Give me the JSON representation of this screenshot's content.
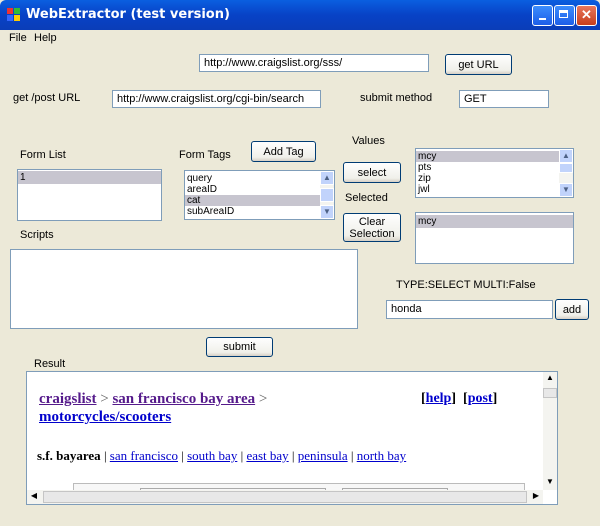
{
  "window": {
    "title": "WebExtractor (test version)"
  },
  "menu": {
    "file": "File",
    "help": "Help"
  },
  "url_input": {
    "value": "http://www.craigslist.org/sss/"
  },
  "get_url_button": "get URL",
  "get_post_label": "get /post URL",
  "post_url_input": {
    "value": "http://www.craigslist.org/cgi-bin/search"
  },
  "submit_method_label": "submit method",
  "submit_method_input": {
    "value": "GET"
  },
  "values_label": "Values",
  "form_list_label": "Form List",
  "form_list": {
    "items": [
      "1"
    ]
  },
  "form_tags_label": "Form Tags",
  "add_tag_button": "Add Tag",
  "form_tags": {
    "items": [
      "query",
      "areaID",
      "cat",
      "subAreaID"
    ],
    "selected_index": 2
  },
  "select_button": "select",
  "values_list": {
    "items": [
      "mcy",
      "pts",
      "zip",
      "jwl"
    ],
    "selected_index": 0
  },
  "selected_label": "Selected",
  "clear_selection_button": {
    "line1": "Clear",
    "line2": "Selection"
  },
  "selected_list": {
    "items": [
      "mcy"
    ]
  },
  "scripts_label": "Scripts",
  "type_info": "TYPE:SELECT MULTI:False",
  "add_input": {
    "value": "honda"
  },
  "add_button": "add",
  "submit_button": "submit",
  "result_label": "Result",
  "result": {
    "crumb_site": "craigslist",
    "crumb_sep1": " > ",
    "crumb_area": "san francisco bay area",
    "crumb_sep2": " >",
    "crumb_cat": "motorcycles/scooters",
    "help_link": "help",
    "post_link": "post",
    "area_label": "s.f. bayarea",
    "subareas": [
      "san francisco",
      "south bay",
      "east bay",
      "peninsula",
      "north bay"
    ]
  }
}
